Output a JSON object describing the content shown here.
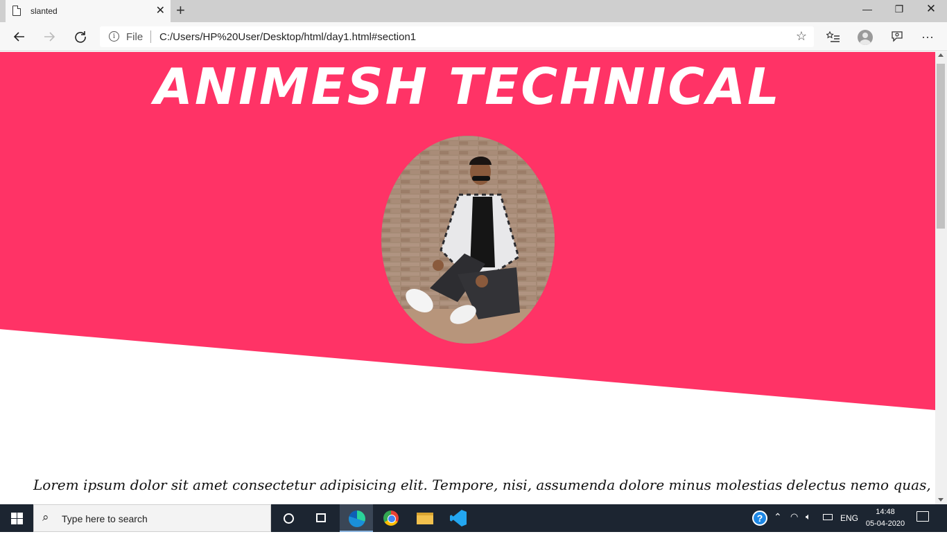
{
  "browser": {
    "tab_title": "slanted",
    "tab_close": "✕",
    "new_tab": "+",
    "url_scheme": "File",
    "url": "C:/Users/HP%20User/Desktop/html/day1.html#section1",
    "window_controls": {
      "minimize": "—",
      "maximize": "❐",
      "close": "✕"
    }
  },
  "page": {
    "heading": "ANIMESH TECHNICAL",
    "hero_color": "#ff3366",
    "body_text": "Lorem ipsum dolor sit amet consectetur adipisicing elit. Tempore, nisi, assumenda dolore minus molestias delectus nemo quas,"
  },
  "taskbar": {
    "search_placeholder": "Type here to search",
    "language": "ENG",
    "time": "14:48",
    "date": "05-04-2020"
  }
}
